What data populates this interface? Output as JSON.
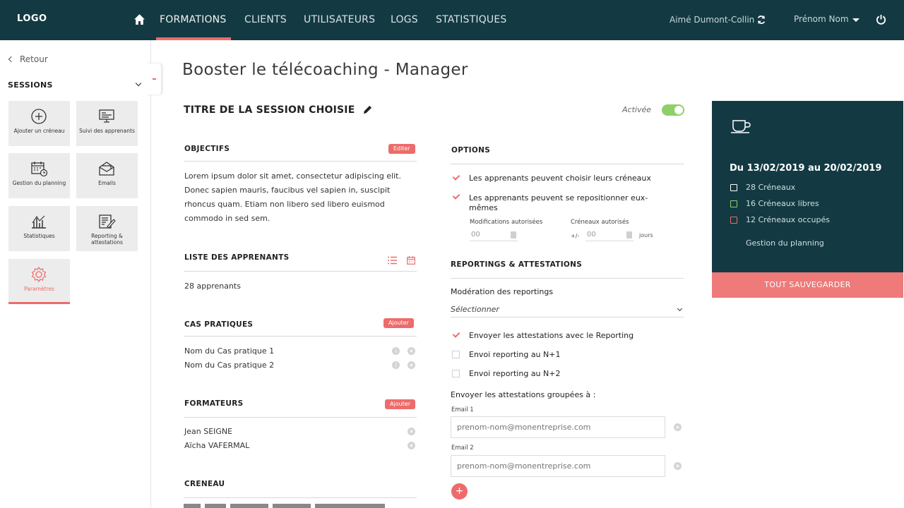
{
  "header": {
    "logo": "LOGO",
    "nav": [
      "FORMATIONS",
      "CLIENTS",
      "UTILISATEURS",
      "LOGS",
      "STATISTIQUES"
    ],
    "active_nav": "FORMATIONS",
    "current_user": "Aimé Dumont-Collin",
    "user_menu": "Prénom Nom"
  },
  "sidebar": {
    "back": "Retour",
    "section": "SESSIONS",
    "tiles": [
      {
        "label": "Ajouter un créneau",
        "icon": "plus-circle-icon"
      },
      {
        "label": "Suivi des apprenants",
        "icon": "monitor-icon"
      },
      {
        "label": "Gestion du planning",
        "icon": "calendar-clock-icon"
      },
      {
        "label": "Emails",
        "icon": "envelope-icon"
      },
      {
        "label": "Statistiques",
        "icon": "chart-icon"
      },
      {
        "label": "Reporting & attestations",
        "icon": "report-icon"
      },
      {
        "label": "Paramètres",
        "icon": "gear-icon"
      }
    ]
  },
  "main": {
    "page_title": "Booster le télécoaching - Manager",
    "session_title": "TITRE DE LA SESSION CHOISIE",
    "status": "Activée",
    "objectives": {
      "title": "OBJECTIFS",
      "action": "Editer",
      "text": "Lorem ipsum dolor sit amet, consectetur adipiscing elit. Donec sapien mauris, faucibus vel sapien in, suscipit rhoncus quam. Etiam non libero sed libero euismod commodo in sed sem."
    },
    "learners": {
      "title": "LISTE DES APPRENANTS",
      "count": "28 apprenants"
    },
    "cases": {
      "title": "CAS PRATIQUES",
      "action": "Ajouter",
      "items": [
        "Nom du Cas pratique 1",
        "Nom du Cas pratique 2"
      ]
    },
    "trainers": {
      "title": "FORMATEURS",
      "action": "Ajouter",
      "items": [
        "Jean SEIGNE",
        "Aïcha VAFERMAL"
      ]
    },
    "slot": {
      "title": "CRENEAU"
    }
  },
  "options": {
    "title": "OPTIONS",
    "opt1": "Les apprenants peuvent choisir leurs créneaux",
    "opt2": "Les apprenants peuvent se repositionner eux-mêmes",
    "mods_label": "Modifications autorisées",
    "mods_value": "00",
    "slots_label": "Créneaux autorisés",
    "slots_prefix": "+/-",
    "slots_value": "00",
    "slots_unit": "jours"
  },
  "reporting": {
    "title": "REPORTINGS & ATTESTATIONS",
    "moderation_label": "Modération des reportings",
    "moderation_value": "Sélectionner",
    "chk1": "Envoyer les attestations avec le Reporting",
    "chk2": "Envoi reporting au N+1",
    "chk3": "Envoi reporting au N+2",
    "group_label": "Envoyer les attestations groupées à :",
    "email1_label": "Email 1",
    "email1_placeholder": "prenom-nom@monentreprise.com",
    "email2_label": "Email 2",
    "email2_placeholder": "prenom-nom@monentreprise.com",
    "add": "+"
  },
  "panel": {
    "dates": "Du 13/02/2019 au 20/02/2019",
    "stat1": "28 Créneaux",
    "stat2": "16 Créneaux libres",
    "stat3": "12 Créneaux occupés",
    "link": "Gestion du planning",
    "save": "TOUT SAUVEGARDER",
    "colors": {
      "stat1": "#ffffff",
      "stat2": "#8fcf6a",
      "stat3": "#ee6b6b"
    }
  },
  "colors": {
    "primary": "#133a43",
    "accent": "#ee6b6b",
    "toggle": "#8fcf6a"
  }
}
